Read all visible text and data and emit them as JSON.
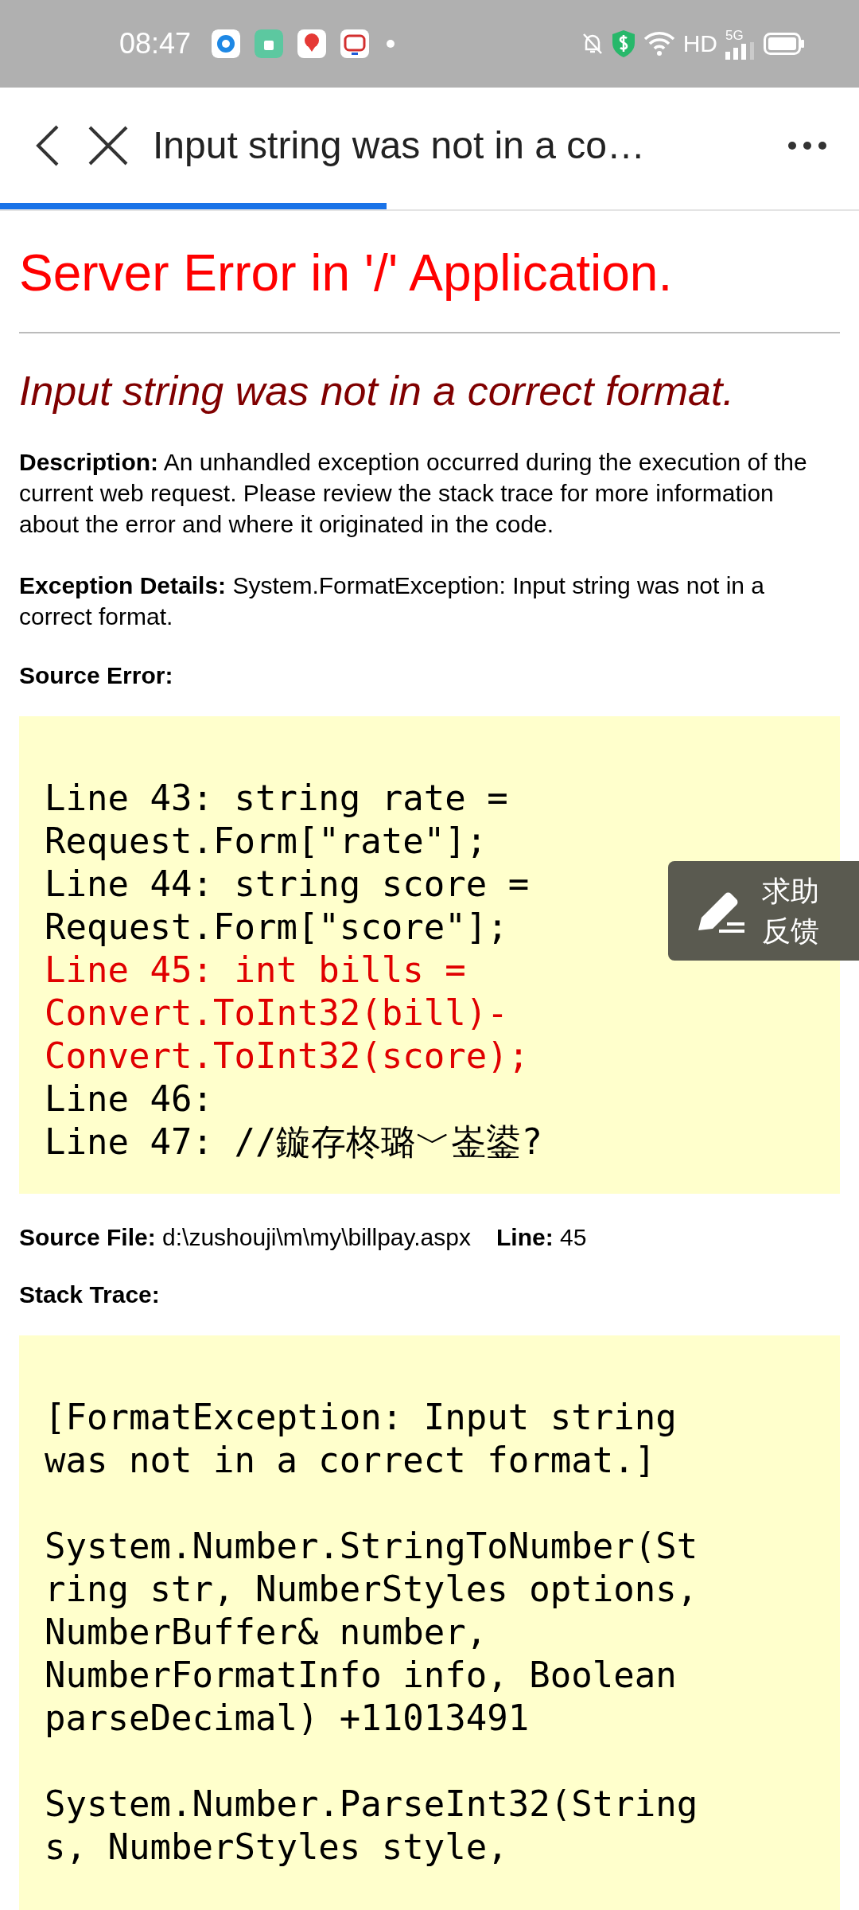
{
  "status_bar": {
    "time": "08:47",
    "hd": "HD",
    "network_type": "5G"
  },
  "toolbar": {
    "title": "Input string was not in a co…"
  },
  "progress": {
    "level": 0.45
  },
  "page": {
    "heading": "Server Error in '/' Application.",
    "error_title": "Input string was not in a correct format.",
    "description": "**Description:** An unhandled exception occurred during the execution of the current web request. Please review the stack trace for more information about the error and where it originated in the code.",
    "exception_details": "**Exception Details:** System.FormatException: Input string was not in a correct format.",
    "source_error_label": "Source Error:",
    "source_lines": [
      {
        "text": "Line 43: string rate = Request.Form[\"rate\"];",
        "highlighted": false
      },
      {
        "text": "Line 44: string score = Request.Form[\"score\"];",
        "highlighted": false
      },
      {
        "text": "Line 45: int bills = Convert.ToInt32(bill)-Convert.ToInt32(score);",
        "highlighted": true
      },
      {
        "text": "Line 46:",
        "highlighted": false
      },
      {
        "text": "Line 47: //鏇存柊璐﹀崟鍙?",
        "highlighted": false
      }
    ],
    "source_file": "**Source File:** d:\\zushouji\\m\\my\\billpay.aspx",
    "source_line": "**Line:** 45",
    "stack_trace_label": "Stack Trace:",
    "stack_entries": [
      "[FormatException: Input string was not in a correct format.]",
      "System.Number.StringToNumber(String str, NumberStyles options, NumberBuffer& number, NumberFormatInfo info, Boolean parseDecimal) +11013491",
      "System.Number.ParseInt32(String s, NumberStyles style,"
    ]
  },
  "feedback_button": {
    "label": "求助反馈"
  }
}
